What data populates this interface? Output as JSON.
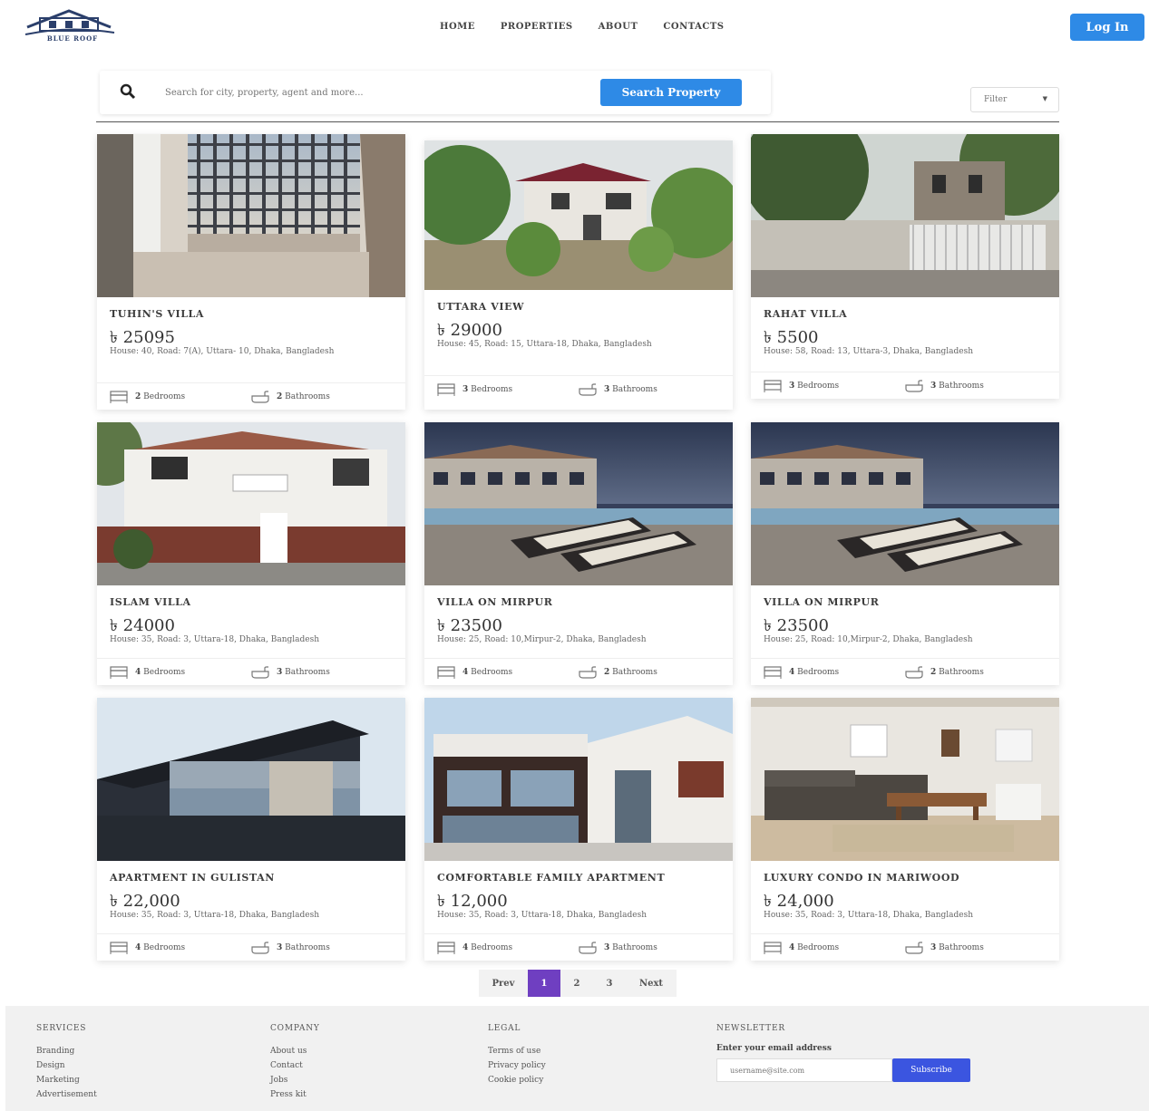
{
  "header": {
    "logo_text": "BLUE ROOF",
    "nav": [
      "HOME",
      "PROPERTIES",
      "ABOUT",
      "CONTACTS"
    ],
    "login_label": "Log In"
  },
  "search": {
    "placeholder": "Search for city, property, agent and more...",
    "button_label": "Search Property",
    "filter_label": "Filter"
  },
  "colors": {
    "accent": "#2e8ae6",
    "pagination_active": "#6f3fc1",
    "subscribe": "#3b55e0"
  },
  "listings": [
    {
      "title": "TUHIN'S VILLA",
      "price": "৳ 25095",
      "address": "House: 40, Road: 7(A), Uttara- 10, Dhaka, Bangladesh",
      "bedrooms": "2",
      "bathrooms": "2"
    },
    {
      "title": "UTTARA VIEW",
      "price": "৳ 29000",
      "address": "House: 45, Road: 15, Uttara-18, Dhaka, Bangladesh",
      "bedrooms": "3",
      "bathrooms": "3"
    },
    {
      "title": "RAHAT VILLA",
      "price": "৳ 5500",
      "address": "House: 58, Road: 13, Uttara-3, Dhaka, Bangladesh",
      "bedrooms": "3",
      "bathrooms": "3"
    },
    {
      "title": "ISLAM VILLA",
      "price": "৳ 24000",
      "address": "House: 35, Road: 3, Uttara-18, Dhaka, Bangladesh",
      "bedrooms": "4",
      "bathrooms": "3"
    },
    {
      "title": "VILLA ON MIRPUR",
      "price": "৳ 23500",
      "address": "House: 25, Road: 10,Mirpur-2, Dhaka, Bangladesh",
      "bedrooms": "4",
      "bathrooms": "2"
    },
    {
      "title": "VILLA ON MIRPUR",
      "price": "৳ 23500",
      "address": "House: 25, Road: 10,Mirpur-2, Dhaka, Bangladesh",
      "bedrooms": "4",
      "bathrooms": "2"
    },
    {
      "title": "APARTMENT IN GULISTAN",
      "price": "৳ 22,000",
      "address": "House: 35, Road: 3, Uttara-18, Dhaka, Bangladesh",
      "bedrooms": "4",
      "bathrooms": "3"
    },
    {
      "title": "COMFORTABLE FAMILY APARTMENT",
      "price": "৳ 12,000",
      "address": "House: 35, Road: 3, Uttara-18, Dhaka, Bangladesh",
      "bedrooms": "4",
      "bathrooms": "3"
    },
    {
      "title": "LUXURY CONDO IN MARIWOOD",
      "price": "৳ 24,000",
      "address": "House: 35, Road: 3, Uttara-18, Dhaka, Bangladesh",
      "bedrooms": "4",
      "bathrooms": "3"
    }
  ],
  "labels": {
    "bedrooms": "Bedrooms",
    "bathrooms": "Bathrooms"
  },
  "pagination": {
    "prev": "Prev",
    "pages": [
      "1",
      "2",
      "3"
    ],
    "next": "Next",
    "current": "1"
  },
  "footer": {
    "services": {
      "heading": "SERVICES",
      "links": [
        "Branding",
        "Design",
        "Marketing",
        "Advertisement"
      ]
    },
    "company": {
      "heading": "COMPANY",
      "links": [
        "About us",
        "Contact",
        "Jobs",
        "Press kit"
      ]
    },
    "legal": {
      "heading": "LEGAL",
      "links": [
        "Terms of use",
        "Privacy policy",
        "Cookie policy"
      ]
    },
    "newsletter": {
      "heading": "NEWSLETTER",
      "label": "Enter your email address",
      "placeholder": "username@site.com",
      "button": "Subscribe"
    }
  }
}
